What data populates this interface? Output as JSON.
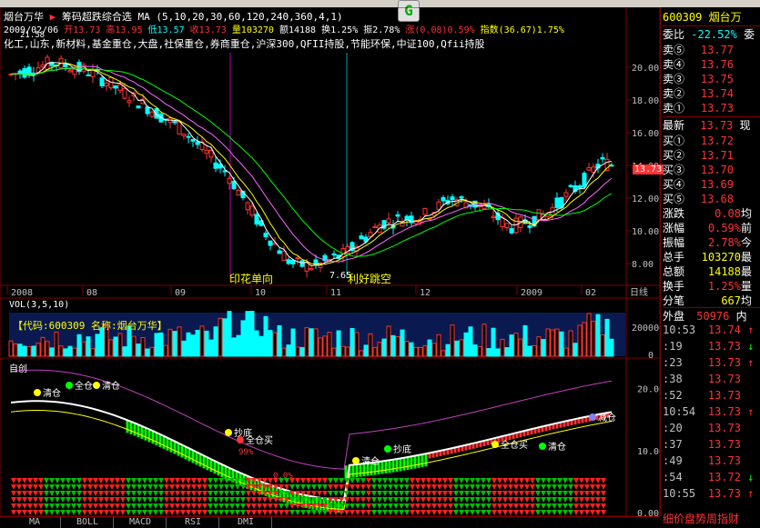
{
  "header": {
    "stock_name": "烟台万华",
    "indicator": "筹码超跌综合选",
    "ma_params": "MA (5,10,20,30,60,120,240,360,4,1)",
    "date": "2009/02/06",
    "open_label": "开13.73",
    "high_label": "高13.95",
    "low_label": "低13.57",
    "close_label": "收13.73",
    "volume_label": "量103270",
    "amount_label": "额14188",
    "turnover_label": "换1.25%",
    "amplitude_label": "振2.78%",
    "change_label": "涨(0.08)0.59%",
    "index_label": "指数(36.67)1.75%",
    "sectors": "化工,山东,新材料,基金重仓,大盘,社保重仓,券商重仓,沪深300,QFII持股,节能环保,中证100,Qfii持股",
    "last_price_tag": "13.73",
    "topleft_price": "21.58",
    "logo_letter": "G"
  },
  "price_axis": [
    "20.00",
    "18.00",
    "16.00",
    "14.00",
    "12.00",
    "10.00",
    "8.00"
  ],
  "date_axis": [
    "2008",
    "08",
    "09",
    "10",
    "11",
    "12",
    "2009",
    "02",
    "日线"
  ],
  "annotations": {
    "event1": "印花单向",
    "event2": "7.65",
    "event3": "利好跳空"
  },
  "volume": {
    "legend": "VOL(3,5,10)",
    "info": "【代码:600309 名称:烟台万华】",
    "axis": [
      "200000",
      "0"
    ]
  },
  "indicator_panel": {
    "name": "自创",
    "axis": [
      "20.00",
      "10.00",
      "0.00"
    ],
    "labels": [
      "清仓",
      "全仓",
      "清仓",
      "抄底",
      "全仓买",
      "抄底",
      "清仓",
      "全仓买",
      "清仓",
      "减仓"
    ],
    "pct1": "0.0%",
    "pct2": "99%"
  },
  "tabs": [
    "MA",
    "BOLL",
    "MACD",
    "RSI",
    "DMI"
  ],
  "quote_panel": {
    "code": "600309",
    "name": "烟台万",
    "wei_bi": "委比",
    "wei_bi_val": "-22.52%",
    "wei_cha": "委",
    "sells": [
      {
        "label": "卖⑤",
        "price": "13.77"
      },
      {
        "label": "卖④",
        "price": "13.76"
      },
      {
        "label": "卖③",
        "price": "13.75"
      },
      {
        "label": "卖②",
        "price": "13.74"
      },
      {
        "label": "卖①",
        "price": "13.73"
      }
    ],
    "latest_label": "最新",
    "latest_price": "13.73",
    "latest_suffix": "现",
    "buys": [
      {
        "label": "买①",
        "price": "13.72"
      },
      {
        "label": "买②",
        "price": "13.71"
      },
      {
        "label": "买③",
        "price": "13.70"
      },
      {
        "label": "买④",
        "price": "13.69"
      },
      {
        "label": "买⑤",
        "price": "13.68"
      }
    ],
    "stats": [
      {
        "label": "涨跌",
        "value": "0.08",
        "suffix": "均"
      },
      {
        "label": "涨幅",
        "value": "0.59%",
        "suffix": "前"
      },
      {
        "label": "振幅",
        "value": "2.78%",
        "suffix": "今"
      },
      {
        "label": "总手",
        "value": "103270",
        "suffix": "最"
      },
      {
        "label": "总额",
        "value": "14188",
        "suffix": "最"
      },
      {
        "label": "换手",
        "value": "1.25%",
        "suffix": "量"
      },
      {
        "label": "分笔",
        "value": "667",
        "suffix": "均"
      }
    ],
    "outer_label": "外盘",
    "outer_value": "50976",
    "inner_label": "内",
    "ticks": [
      {
        "time": "10:53",
        "price": "13.74",
        "arrow": "↑"
      },
      {
        "time": ":19",
        "price": "13.73",
        "arrow": "↓"
      },
      {
        "time": ":23",
        "price": "13.73",
        "arrow": "↑"
      },
      {
        "time": ":38",
        "price": "13.73",
        "arrow": ""
      },
      {
        "time": ":52",
        "price": "13.73",
        "arrow": ""
      },
      {
        "time": "10:54",
        "price": "13.73",
        "arrow": "↑"
      },
      {
        "time": ":20",
        "price": "13.73",
        "arrow": ""
      },
      {
        "time": ":37",
        "price": "13.73",
        "arrow": ""
      },
      {
        "time": ":49",
        "price": "13.73",
        "arrow": ""
      },
      {
        "time": ":54",
        "price": "13.72",
        "arrow": "↓"
      },
      {
        "time": "10:55",
        "price": "13.73",
        "arrow": "↑"
      }
    ],
    "bottom_tabs": "细价盘势周指财"
  },
  "colors": {
    "up": "#ff3333",
    "down": "#00ffff",
    "ma5": "#ffffff",
    "ma10": "#ffff00",
    "ma20": "#ff66ff",
    "ma30": "#00ff00",
    "border": "#800000"
  }
}
